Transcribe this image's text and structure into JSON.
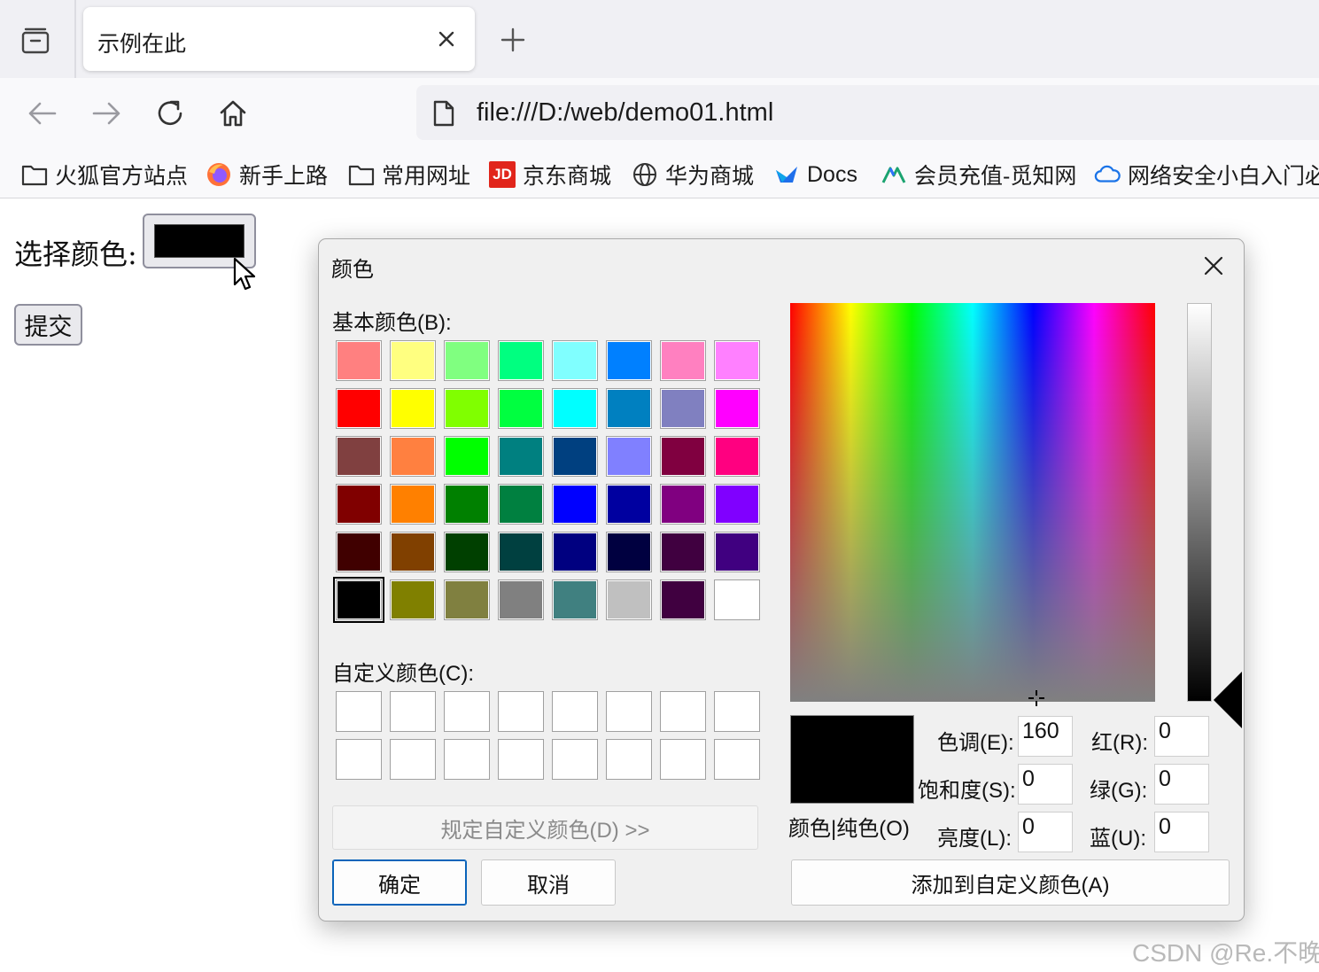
{
  "browser": {
    "tab_title": "示例在此",
    "url": "file:///D:/web/demo01.html",
    "bookmarks": [
      {
        "label": "火狐官方站点",
        "icon": "folder-icon"
      },
      {
        "label": "新手上路",
        "icon": "firefox-icon"
      },
      {
        "label": "常用网址",
        "icon": "folder-icon"
      },
      {
        "label": "京东商城",
        "icon": "jd-icon"
      },
      {
        "label": "华为商城",
        "icon": "globe-icon"
      },
      {
        "label": "Docs",
        "icon": "docs-icon"
      },
      {
        "label": "会员充值-觅知网",
        "icon": "mizhi-icon"
      },
      {
        "label": "网络安全小白入门必",
        "icon": "cloud-icon"
      }
    ],
    "jd_badge": "JD"
  },
  "page": {
    "color_label": "选择颜色:",
    "color_value": "#000000",
    "submit_label": "提交"
  },
  "dialog": {
    "title": "颜色",
    "basic_colors_label": "基本颜色(B):",
    "basic_colors": [
      [
        "#ff8080",
        "#ffff80",
        "#80ff80",
        "#00ff80",
        "#80ffff",
        "#0080ff",
        "#ff80c0",
        "#ff80ff"
      ],
      [
        "#ff0000",
        "#ffff00",
        "#80ff00",
        "#00ff40",
        "#00ffff",
        "#0080c0",
        "#8080c0",
        "#ff00ff"
      ],
      [
        "#804040",
        "#ff8040",
        "#00ff00",
        "#008080",
        "#004080",
        "#8080ff",
        "#800040",
        "#ff0080"
      ],
      [
        "#800000",
        "#ff8000",
        "#008000",
        "#008040",
        "#0000ff",
        "#0000a0",
        "#800080",
        "#8000ff"
      ],
      [
        "#400000",
        "#804000",
        "#004000",
        "#004040",
        "#000080",
        "#000040",
        "#400040",
        "#400080"
      ],
      [
        "#000000",
        "#808000",
        "#808040",
        "#808080",
        "#408080",
        "#c0c0c0",
        "#400040",
        "#ffffff"
      ]
    ],
    "selected_basic": "#000000",
    "custom_colors_label": "自定义颜色(C):",
    "define_custom_label": "规定自定义颜色(D) >>",
    "ok_label": "确定",
    "cancel_label": "取消",
    "preview_label": "颜色|纯色(O)",
    "fields": {
      "hue_label": "色调(E):",
      "hue": "160",
      "sat_label": "饱和度(S):",
      "sat": "0",
      "lum_label": "亮度(L):",
      "lum": "0",
      "red_label": "红(R):",
      "red": "0",
      "green_label": "绿(G):",
      "green": "0",
      "blue_label": "蓝(U):",
      "blue": "0"
    },
    "add_custom_label": "添加到自定义颜色(A)"
  },
  "watermark": "CSDN @Re.不晚"
}
